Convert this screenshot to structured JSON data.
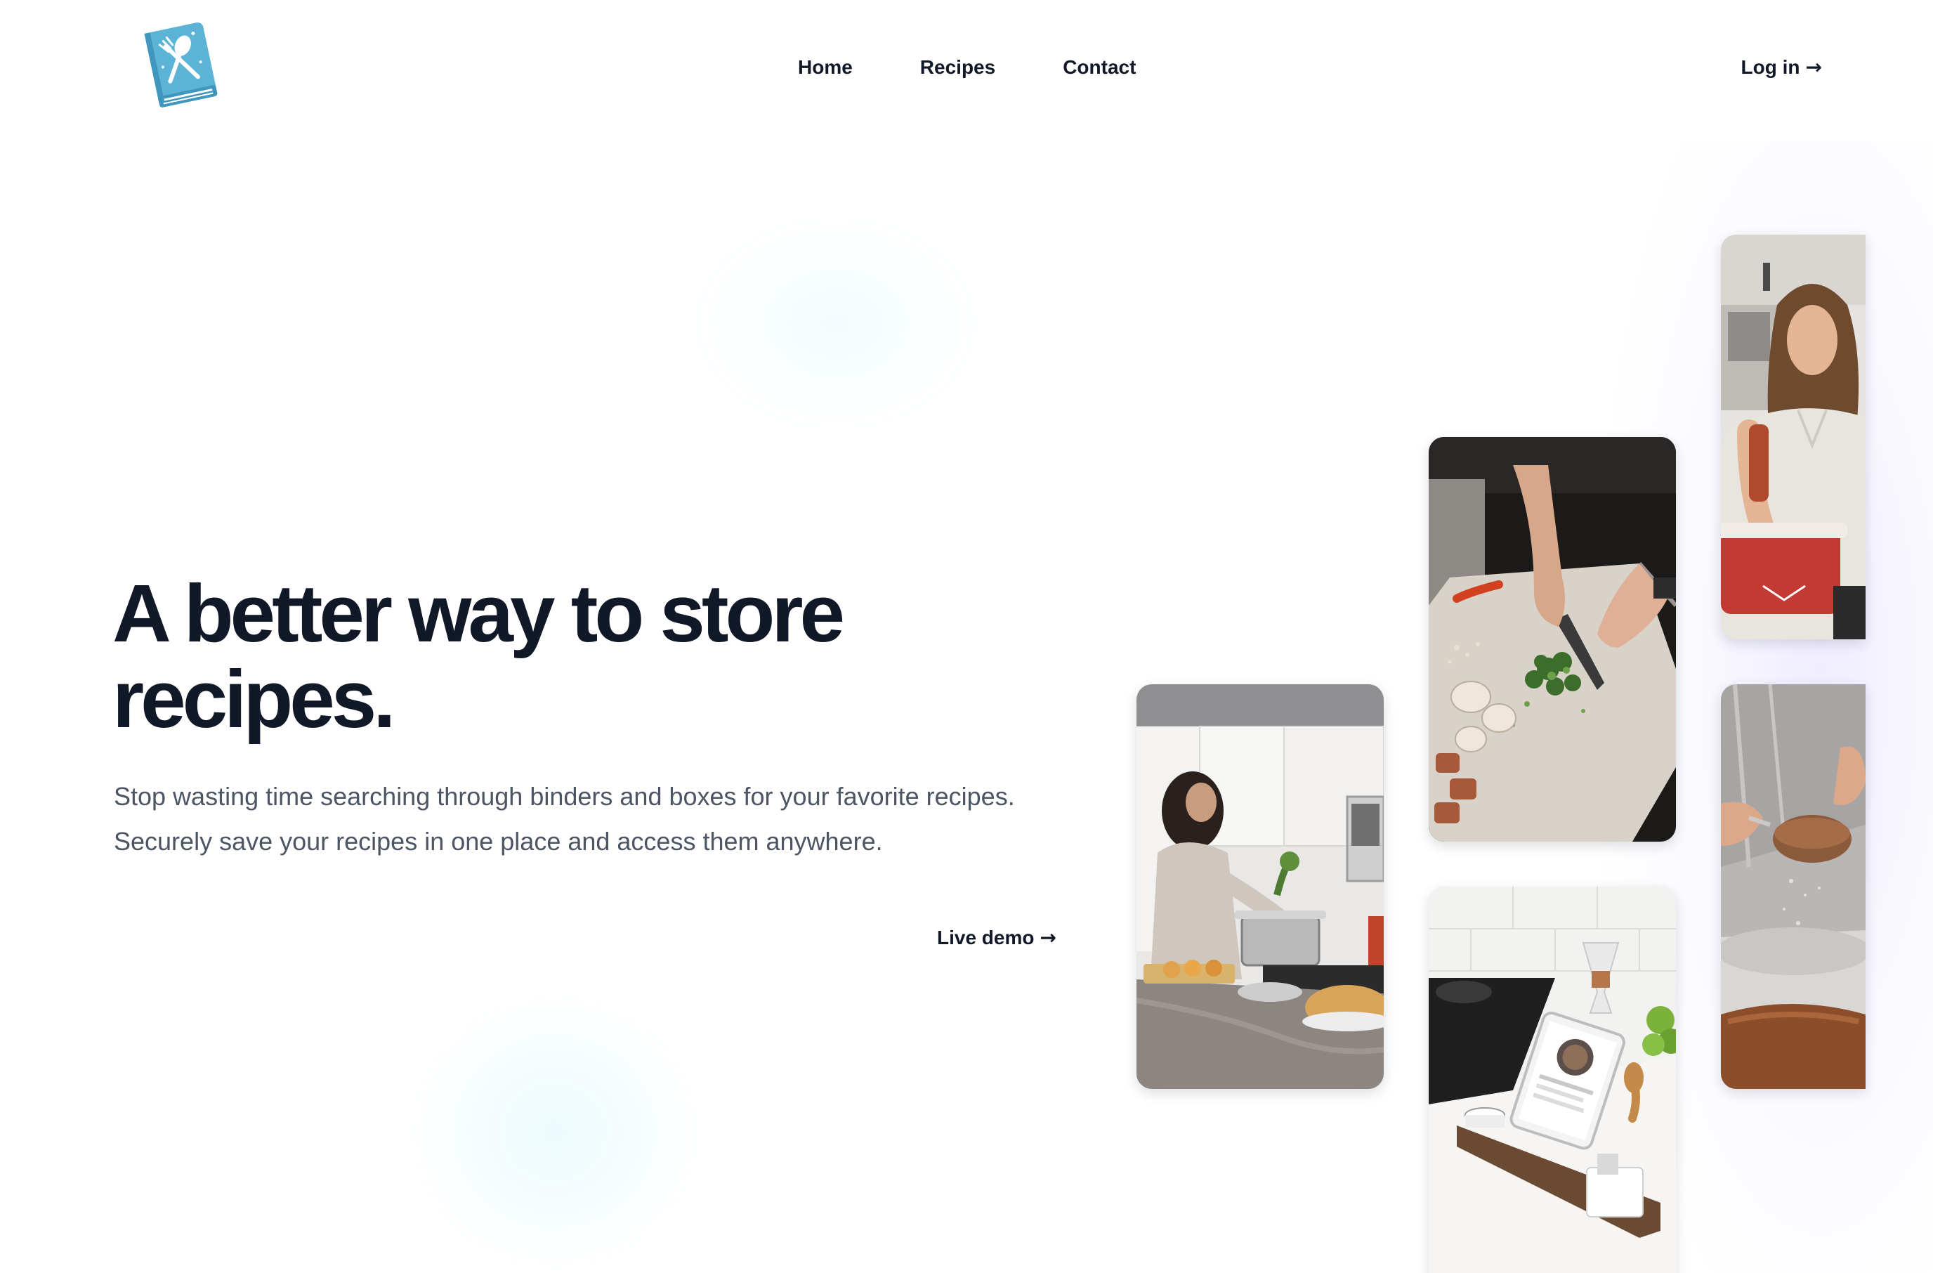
{
  "nav": {
    "logo_label": "Recipe book logo",
    "items": [
      {
        "label": "Home"
      },
      {
        "label": "Recipes"
      },
      {
        "label": "Contact"
      }
    ],
    "login": {
      "label": "Log in",
      "arrow": "→"
    }
  },
  "hero": {
    "title_line1": "A better way to store",
    "title_line2": "recipes.",
    "subtitle_line1": "Stop wasting time searching through binders and boxes for your favorite recipes.",
    "subtitle_line2": "Securely save your recipes in one place and access them anywhere.",
    "cta": {
      "label": "Live demo",
      "arrow": "→"
    }
  },
  "gallery": {
    "photos": [
      {
        "name": "woman-cooking-photo"
      },
      {
        "name": "chopping-herbs-photo"
      },
      {
        "name": "tablet-recipe-stand-photo"
      },
      {
        "name": "woman-pepper-grinder-photo"
      },
      {
        "name": "sifting-cocoa-photo"
      }
    ]
  },
  "colors": {
    "text_primary": "#111827",
    "text_secondary": "#4b5563",
    "logo_blue": "#5bb3d6",
    "grid_line": "#dff3fb"
  }
}
